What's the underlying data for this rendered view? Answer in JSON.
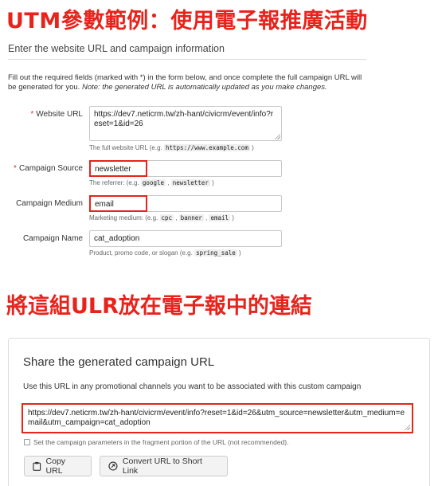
{
  "annotations": {
    "top_heading": "UTM參數範例：使用電子報推廣活動",
    "middle_heading": "將這組ULR放在電子報中的連結"
  },
  "form": {
    "section_title": "Enter the website URL and campaign information",
    "intro_text": "Fill out the required fields (marked with *) in the form below, and once complete the full campaign URL will be generated for you.",
    "intro_note": "Note: the generated URL is automatically updated as you make changes.",
    "required_marker": "*",
    "website_url": {
      "label": "Website URL",
      "value": "https://dev7.neticrm.tw/zh-hant/civicrm/event/info?reset=1&id=26",
      "help_prefix": "The full website URL (e.g.",
      "help_example": "https://www.example.com",
      "help_suffix": ")"
    },
    "campaign_source": {
      "label": "Campaign Source",
      "value": "newsletter",
      "help_prefix": "The referrer: (e.g.",
      "help_examples": [
        "google",
        "newsletter"
      ],
      "help_suffix": ")"
    },
    "campaign_medium": {
      "label": "Campaign Medium",
      "value": "email",
      "help_prefix": "Marketing medium: (e.g.",
      "help_examples": [
        "cpc",
        "banner",
        "email"
      ],
      "help_suffix": ")"
    },
    "campaign_name": {
      "label": "Campaign Name",
      "value": "cat_adoption",
      "help_prefix": "Product, promo code, or slogan (e.g.",
      "help_example": "spring_sale",
      "help_suffix": ")"
    }
  },
  "share": {
    "title": "Share the generated campaign URL",
    "description": "Use this URL in any promotional channels you want to be associated with this custom campaign",
    "generated_url": "https://dev7.neticrm.tw/zh-hant/civicrm/event/info?reset=1&id=26&utm_source=newsletter&utm_medium=email&utm_campaign=cat_adoption",
    "fragment_checkbox_label": "Set the campaign parameters in the fragment portion of the URL (not recommended).",
    "fragment_checked": false,
    "copy_button": "Copy URL",
    "short_link_button": "Convert URL to Short Link"
  },
  "colors": {
    "annotation_red": "#e8231c",
    "required_star": "#dd3333"
  },
  "icons": {
    "copy": "clipboard-icon",
    "short_link": "link-icon"
  }
}
